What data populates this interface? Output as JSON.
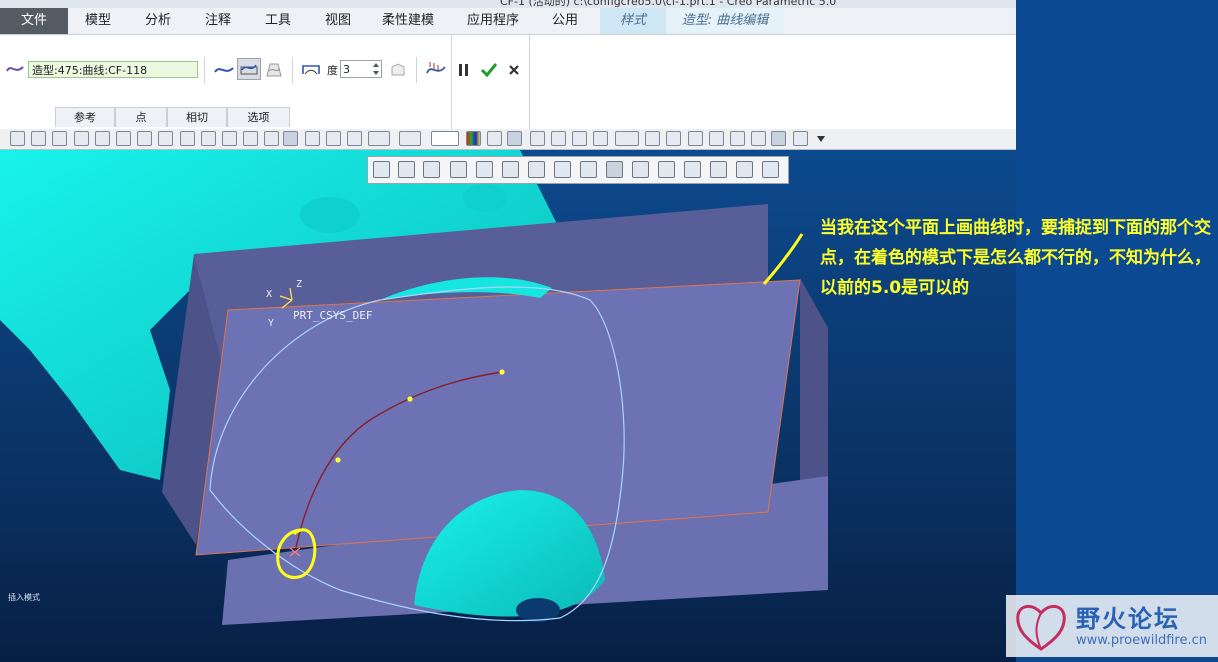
{
  "window": {
    "title": "CF-1 (活动的) c:\\configcreo5.0\\cf-1.prt.1 - Creo Parametric 5.0"
  },
  "ribbon": {
    "tabs": [
      {
        "label": "文件"
      },
      {
        "label": "模型"
      },
      {
        "label": "分析"
      },
      {
        "label": "注释"
      },
      {
        "label": "工具"
      },
      {
        "label": "视图"
      },
      {
        "label": "柔性建模"
      },
      {
        "label": "应用程序"
      },
      {
        "label": "公用"
      },
      {
        "label": "样式"
      },
      {
        "label": "造型: 曲线编辑"
      }
    ],
    "curve_reference": "造型:475:曲线:CF-118",
    "degree_label": "度",
    "degree_value": "3",
    "subtabs": [
      {
        "label": "参考"
      },
      {
        "label": "点"
      },
      {
        "label": "相切"
      },
      {
        "label": "选项"
      }
    ]
  },
  "viewport": {
    "csys_label": "PRT_CSYS_DEF",
    "axis_x": "X",
    "axis_y": "Y",
    "axis_z": "Z",
    "mode_text": "插入模式"
  },
  "annotation": {
    "text": "当我在这个平面上画曲线时，要捕捉到下面的那个交点，在着色的模式下是怎么都不行的，不知为什么，以前的5.0是可以的"
  },
  "watermark": {
    "title": "野火论坛",
    "url": "www.proewildfire.cn"
  },
  "colors": {
    "viewport_bg": "#0c4a8e",
    "plane": "#6c72b4",
    "mesh": "#17e8e2",
    "annotation": "#ffff2a",
    "accent_green": "#1e9e2a"
  }
}
